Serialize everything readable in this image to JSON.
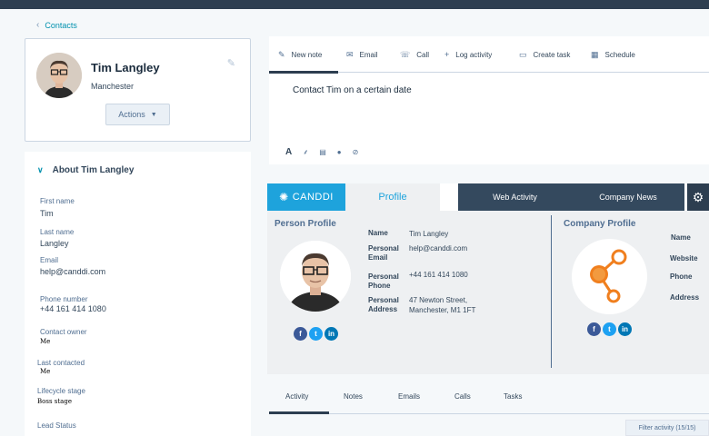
{
  "breadcrumb": {
    "label": "Contacts"
  },
  "profile": {
    "name": "Tim Langley",
    "city": "Manchester",
    "actions_label": "Actions"
  },
  "about": {
    "title": "About Tim Langley",
    "fields": [
      {
        "label": "First name",
        "value": "Tim"
      },
      {
        "label": "Last name",
        "value": "Langley"
      },
      {
        "label": "Email",
        "value": "help@canddi.com"
      },
      {
        "label": "Phone number",
        "value": "+44 161 414 1080"
      },
      {
        "label": "Contact owner",
        "value": "Me"
      },
      {
        "label": "Last contacted",
        "value": "Me"
      },
      {
        "label": "Lifecycle stage",
        "value": "Boss stage"
      },
      {
        "label": "Lead Status",
        "value": ""
      }
    ]
  },
  "activity_tabs": [
    "New note",
    "Email",
    "Call",
    "Log activity",
    "Create task",
    "Schedule"
  ],
  "note": {
    "text": "Contact Tim on a certain date"
  },
  "widget": {
    "logo_text": "CANDDI",
    "tabs": [
      "Profile",
      "Web Activity",
      "Company News"
    ],
    "person_profile": {
      "title": "Person Profile",
      "fields": [
        {
          "label": "Name",
          "value": "Tim Langley"
        },
        {
          "label": "Personal Email",
          "value": "help@canddi.com"
        },
        {
          "label": "Personal Phone",
          "value": "+44 161 414 1080"
        },
        {
          "label": "Personal Address",
          "value": "47 Newton Street, Manchester, M1 1FT"
        }
      ]
    },
    "company_profile": {
      "title": "Company Profile",
      "labels": [
        "Name",
        "Website",
        "Phone",
        "Address"
      ]
    },
    "social": [
      "f",
      "t",
      "in"
    ]
  },
  "bottom_tabs": [
    "Activity",
    "Notes",
    "Emails",
    "Calls",
    "Tasks"
  ],
  "filter": {
    "label": "Filter activity (15/15)"
  },
  "colors": {
    "accent": "#1ea3dc",
    "nav_dark": "#34495e",
    "topbar": "#2d3e50",
    "candidate_orange": "#f07f1e"
  }
}
